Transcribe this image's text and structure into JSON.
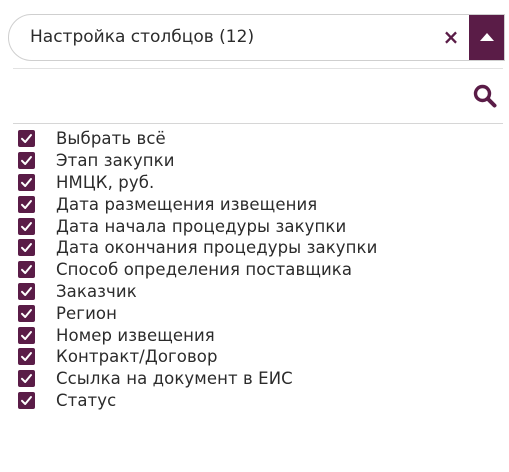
{
  "combo": {
    "title": "Настройка столбцов (12)",
    "clear_icon": "×",
    "toggle_icon": "caret-up-icon"
  },
  "search": {
    "icon": "search-icon"
  },
  "colors": {
    "accent": "#5a1c47",
    "text": "#2b2b2b",
    "border": "#cfcfcf"
  },
  "options": [
    {
      "label": "Выбрать всё",
      "checked": true
    },
    {
      "label": "Этап закупки",
      "checked": true
    },
    {
      "label": "НМЦК, руб.",
      "checked": true
    },
    {
      "label": "Дата размещения извещения",
      "checked": true
    },
    {
      "label": "Дата начала процедуры закупки",
      "checked": true
    },
    {
      "label": "Дата окончания процедуры закупки",
      "checked": true
    },
    {
      "label": "Способ определения поставщика",
      "checked": true
    },
    {
      "label": "Заказчик",
      "checked": true
    },
    {
      "label": "Регион",
      "checked": true
    },
    {
      "label": "Номер извещения",
      "checked": true
    },
    {
      "label": "Контракт/Договор",
      "checked": true
    },
    {
      "label": "Ссылка на документ в ЕИС",
      "checked": true
    },
    {
      "label": "Статус",
      "checked": true
    }
  ]
}
